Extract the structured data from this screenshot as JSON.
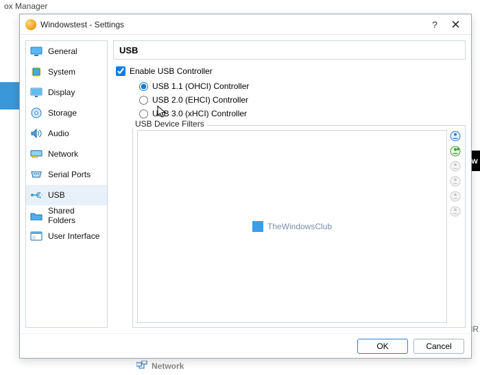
{
  "underlay": {
    "title_fragment": "ox Manager",
    "right_fragment": "ow",
    "right_code": "_OEMR",
    "bottom_label": "Network"
  },
  "dialog": {
    "title": "Windowstest - Settings",
    "help": "?",
    "ok": "OK",
    "cancel": "Cancel"
  },
  "sidebar": {
    "items": [
      {
        "label": "General"
      },
      {
        "label": "System"
      },
      {
        "label": "Display"
      },
      {
        "label": "Storage"
      },
      {
        "label": "Audio"
      },
      {
        "label": "Network"
      },
      {
        "label": "Serial Ports"
      },
      {
        "label": "USB"
      },
      {
        "label": "Shared Folders"
      },
      {
        "label": "User Interface"
      }
    ],
    "selected_index": 7
  },
  "panel": {
    "header": "USB",
    "enable_label": "Enable USB Controller",
    "enable_checked": true,
    "radios": [
      {
        "label": "USB 1.1 (OHCI) Controller",
        "checked": true
      },
      {
        "label": "USB 2.0 (EHCI) Controller",
        "checked": false
      },
      {
        "label": "USB 3.0 (xHCI) Controller",
        "checked": false
      }
    ],
    "filters_label": "USB Device Filters",
    "watermark": "TheWindowsClub"
  }
}
